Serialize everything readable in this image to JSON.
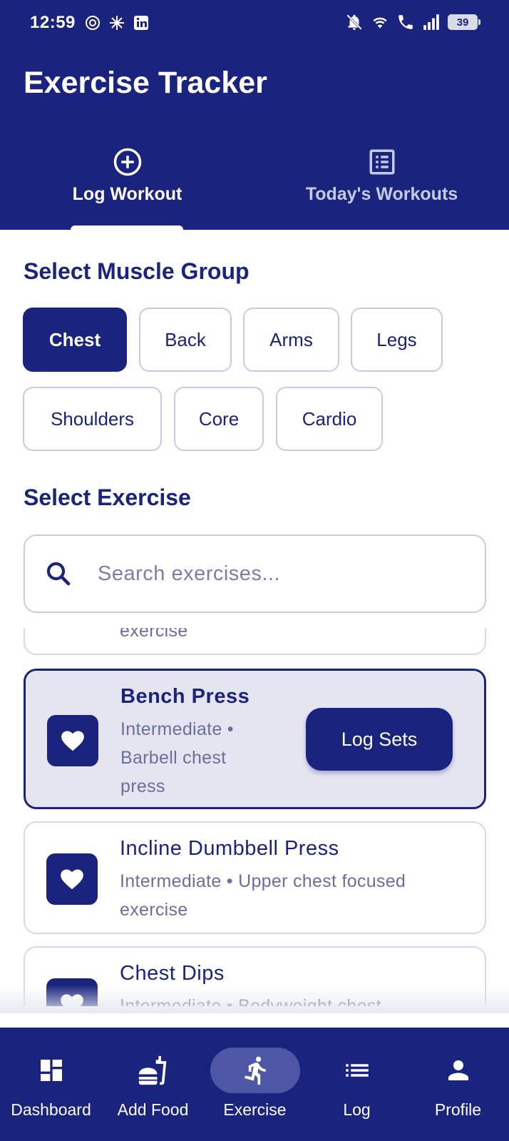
{
  "status_bar": {
    "time": "12:59",
    "battery": "39"
  },
  "app": {
    "title": "Exercise Tracker"
  },
  "tabs": [
    {
      "label": "Log Workout",
      "icon": "add-circle-icon",
      "active": true
    },
    {
      "label": "Today's Workouts",
      "icon": "list-alt-icon",
      "active": false
    }
  ],
  "muscle_section": {
    "title": "Select Muscle Group",
    "groups": [
      "Chest",
      "Back",
      "Arms",
      "Legs",
      "Shoulders",
      "Core",
      "Cardio"
    ],
    "selected": "Chest"
  },
  "exercise_section": {
    "title": "Select Exercise",
    "search_placeholder": "Search exercises...",
    "partial_card_text": "exercise",
    "exercises": [
      {
        "name": "Bench Press",
        "desc_line1": "Intermediate •",
        "desc_line2": "Barbell chest",
        "desc_line3": "press",
        "selected": true,
        "action": "Log Sets"
      },
      {
        "name": "Incline Dumbbell Press",
        "desc_line1": "Intermediate • Upper chest focused",
        "desc_line2": "exercise",
        "selected": false
      },
      {
        "name": "Chest Dips",
        "desc_line1": "Intermediate • Bodyweight chest",
        "selected": false
      }
    ]
  },
  "bottom_nav": [
    {
      "label": "Dashboard",
      "icon": "dashboard-icon",
      "active": false
    },
    {
      "label": "Add Food",
      "icon": "fastfood-icon",
      "active": false
    },
    {
      "label": "Exercise",
      "icon": "directions-run-icon",
      "active": true
    },
    {
      "label": "Log",
      "icon": "list-icon",
      "active": false
    },
    {
      "label": "Profile",
      "icon": "person-icon",
      "active": false
    }
  ],
  "colors": {
    "primary": "#1a237e",
    "selected_card_bg": "#e4e5f0",
    "muted_text": "#6a6f9c"
  }
}
